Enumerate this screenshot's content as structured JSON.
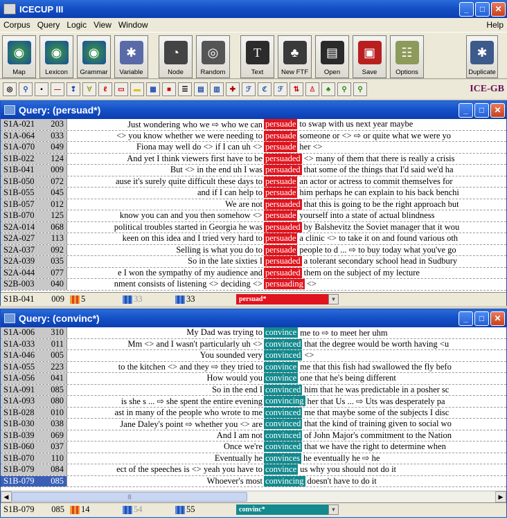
{
  "app": {
    "title": "ICECUP III"
  },
  "menu": [
    "Corpus",
    "Query",
    "Logic",
    "View",
    "Window"
  ],
  "menu_help": "Help",
  "toolbar": [
    {
      "label": "Map",
      "icon": "globe-icon"
    },
    {
      "label": "Lexicon",
      "icon": "globe-lexicon-icon"
    },
    {
      "label": "Grammar",
      "icon": "globe-grammar-icon"
    },
    {
      "label": "Variable",
      "icon": "variable-icon"
    },
    {
      "label": "Node",
      "icon": "node-icon"
    },
    {
      "label": "Random",
      "icon": "random-icon"
    },
    {
      "label": "Text",
      "icon": "text-icon"
    },
    {
      "label": "New FTF",
      "icon": "tree-icon"
    },
    {
      "label": "Open",
      "icon": "open-icon"
    },
    {
      "label": "Save",
      "icon": "save-icon"
    },
    {
      "label": "Options",
      "icon": "options-icon"
    },
    {
      "label": "Duplicate",
      "icon": "duplicate-icon"
    }
  ],
  "iconbar_brand": "ICE-GB",
  "query1": {
    "title": "Query: (persuad*)",
    "rows": [
      {
        "id": "S1A-021",
        "num": "203",
        "left": "Just wondering who we ⇨ who we can",
        "kw": "persuade",
        "right": "to swap with us next year maybe"
      },
      {
        "id": "S1A-064",
        "num": "033",
        "left": "<> you know whether we were needing to",
        "kw": "persuade",
        "right": "someone or <> ⇨ or quite what we were yo"
      },
      {
        "id": "S1A-070",
        "num": "049",
        "left": "Fiona may well do <> if I can uh <>",
        "kw": "persuade",
        "right": "her <>"
      },
      {
        "id": "S1B-022",
        "num": "124",
        "left": "And yet I think viewers first have to be",
        "kw": "persuaded",
        "right": "<> many of them that there is really a crisis"
      },
      {
        "id": "S1B-041",
        "num": "009",
        "left": "But <> in the end uh I was",
        "kw": "persuaded",
        "right": "that some of the things that I'd said we'd ha"
      },
      {
        "id": "S1B-050",
        "num": "072",
        "left": "ause it's surely quite difficult these days to",
        "kw": "persuade",
        "right": "an actor or actress to commit themselves for"
      },
      {
        "id": "S1B-055",
        "num": "045",
        "left": "and if I can help to",
        "kw": "persuade",
        "right": "him perhaps he can explain to his back benchi"
      },
      {
        "id": "S1B-057",
        "num": "012",
        "left": "We are not",
        "kw": "persuaded",
        "right": "that this is going to be the right approach but"
      },
      {
        "id": "S1B-070",
        "num": "125",
        "left": "know you can and you then somehow <>",
        "kw": "persuade",
        "right": "yourself into a state of actual blindness"
      },
      {
        "id": "S2A-014",
        "num": "068",
        "left": "political troubles started in Georgia he was",
        "kw": "persuaded",
        "right": "by Balshevitz the Soviet manager that it wou"
      },
      {
        "id": "S2A-027",
        "num": "113",
        "left": "keen on this idea and I tried very hard to",
        "kw": "persuade",
        "right": "a clinic <> to take it on and found various oth"
      },
      {
        "id": "S2A-037",
        "num": "092",
        "left": "Selling is what you do to",
        "kw": "persuade",
        "right": "people to d ... ⇨ to buy today what you've go"
      },
      {
        "id": "S2A-039",
        "num": "035",
        "left": "So in the late sixties I",
        "kw": "persuaded",
        "right": "a tolerant secondary school head in Sudbury"
      },
      {
        "id": "S2A-044",
        "num": "077",
        "left": "e I won the sympathy of my audience and",
        "kw": "persuaded",
        "right": "them on the subject of my lecture"
      },
      {
        "id": "S2B-003",
        "num": "040",
        "left": "nment consists of listening <> deciding <>",
        "kw": "persuading",
        "right": "<>"
      }
    ],
    "status": {
      "id": "S1B-041",
      "num": "009",
      "count1": "5",
      "count2": "33",
      "count3": "33",
      "query": "persuad*"
    }
  },
  "query2": {
    "title": "Query: (convinc*)",
    "rows": [
      {
        "id": "S1A-006",
        "num": "310",
        "left": "My Dad was trying to",
        "kw": "convince",
        "right": "me to ⇨ to meet her uhm"
      },
      {
        "id": "S1A-033",
        "num": "011",
        "left": "Mm <> and I wasn't particularly uh <>",
        "kw": "convinced",
        "right": "that the degree would be worth having <u"
      },
      {
        "id": "S1A-046",
        "num": "005",
        "left": "You sounded very",
        "kw": "convinced",
        "right": "<>"
      },
      {
        "id": "S1A-055",
        "num": "223",
        "left": "to the kitchen <> and they ⇨ they tried to",
        "kw": "convince",
        "right": "me that this fish had swallowed the fly befo"
      },
      {
        "id": "S1A-056",
        "num": "041",
        "left": "How would you",
        "kw": "convince",
        "right": "one that he's being different"
      },
      {
        "id": "S1A-091",
        "num": "085",
        "left": "So in the end I",
        "kw": "convinced",
        "right": "him that he was predictable in a posher sc"
      },
      {
        "id": "S1A-093",
        "num": "080",
        "left": "is she s ... ⇨ she spent the entire evening",
        "kw": "convincing",
        "right": "her that Us ... ⇨ Uts was desperately pa"
      },
      {
        "id": "S1B-028",
        "num": "010",
        "left": "ast in many of the people who wrote to me",
        "kw": "convinced",
        "right": "me that maybe some of the subjects I disc"
      },
      {
        "id": "S1B-030",
        "num": "038",
        "left": "Jane Daley's point ⇨ whether you <> are",
        "kw": "convinced",
        "right": "that the kind of training given to social wo"
      },
      {
        "id": "S1B-039",
        "num": "069",
        "left": "And I am not",
        "kw": "convinced",
        "right": "of John Major's commitment to the Nation"
      },
      {
        "id": "S1B-060",
        "num": "037",
        "left": "Once we're",
        "kw": "convinced",
        "right": "that we have the right to determine when"
      },
      {
        "id": "S1B-070",
        "num": "110",
        "left": "Eventually he",
        "kw": "convinces",
        "right": "he eventually he ⇨ he"
      },
      {
        "id": "S1B-079",
        "num": "084",
        "left": "ect of the speeches is <> yeah you have to",
        "kw": "convince",
        "right": "us why you should not do it"
      },
      {
        "id": "S1B-079",
        "num": "085",
        "left": "Whoever's most",
        "kw": "convincing",
        "right": "doesn't have to do it",
        "selected": true
      }
    ],
    "status": {
      "id": "S1B-079",
      "num": "085",
      "count1": "14",
      "count2": "54",
      "count3": "55",
      "query": "convinc*"
    }
  },
  "colors": {
    "persuade_kw": "#e0141e",
    "convince_kw": "#138a8e",
    "titlebar": "#1450c7"
  }
}
